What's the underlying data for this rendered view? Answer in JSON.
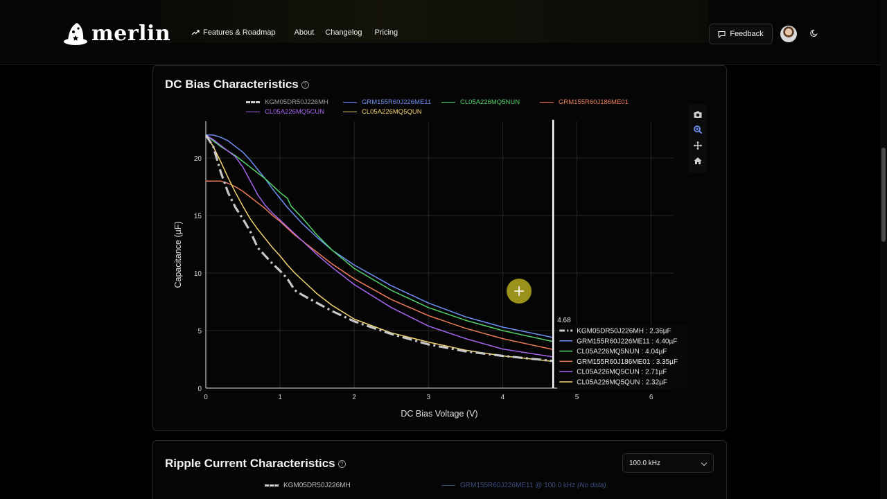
{
  "nav": {
    "brand": "merlin",
    "links": [
      "Features & Roadmap",
      "About",
      "Changelog",
      "Pricing"
    ],
    "feedback_label": "Feedback"
  },
  "dc_card": {
    "title": "DC Bias Characteristics",
    "help": "?"
  },
  "chart_data": {
    "type": "line",
    "xlabel": "DC Bias Voltage (V)",
    "ylabel": "Capacitance (µF)",
    "xlim": [
      0,
      6.3
    ],
    "ylim": [
      0,
      23.2
    ],
    "xticks": [
      0,
      1,
      2,
      3,
      4,
      5,
      6
    ],
    "yticks": [
      0,
      5,
      10,
      15,
      20
    ],
    "grid": true,
    "legend_position": "top",
    "series": [
      {
        "name": "KGM05DR50J226MH",
        "color": "#c8c8c8",
        "dash": "dashdot",
        "x": [
          0,
          0.1,
          0.2,
          0.3,
          0.4,
          0.5,
          0.6,
          0.7,
          0.8,
          0.9,
          1.0,
          1.1,
          1.2,
          1.3,
          1.5,
          1.7,
          2.0,
          2.5,
          3.0,
          3.5,
          4.0,
          4.68
        ],
        "y": [
          22.0,
          21.0,
          18.8,
          17.0,
          15.7,
          14.7,
          13.6,
          12.2,
          11.5,
          10.8,
          10.2,
          9.5,
          8.5,
          8.1,
          7.4,
          6.7,
          5.8,
          4.7,
          3.8,
          3.2,
          2.8,
          2.36
        ]
      },
      {
        "name": "GRM155R60J226ME11",
        "color": "#6f8ff5",
        "dash": "solid",
        "x": [
          0,
          0.1,
          0.2,
          0.3,
          0.4,
          0.5,
          0.6,
          0.7,
          0.8,
          0.9,
          1.0,
          1.1,
          1.2,
          1.3,
          1.5,
          1.7,
          2.0,
          2.5,
          3.0,
          3.5,
          4.0,
          4.68
        ],
        "y": [
          22.0,
          22.0,
          21.8,
          21.5,
          21.0,
          20.5,
          19.8,
          19.0,
          18.2,
          17.3,
          16.5,
          15.7,
          15.0,
          14.3,
          13.1,
          12.0,
          10.7,
          8.9,
          7.4,
          6.2,
          5.3,
          4.4
        ]
      },
      {
        "name": "CL05A226MQ5NUN",
        "color": "#54d46a",
        "dash": "solid",
        "x": [
          0,
          0.1,
          0.2,
          0.3,
          0.4,
          0.5,
          0.6,
          0.7,
          0.8,
          0.9,
          1.0,
          1.1,
          1.12,
          1.15,
          1.3,
          1.5,
          1.7,
          2.0,
          2.5,
          3.0,
          3.5,
          4.0,
          4.68
        ],
        "y": [
          22.0,
          21.5,
          21.0,
          20.6,
          20.2,
          19.7,
          19.2,
          18.7,
          18.2,
          17.6,
          17.0,
          16.5,
          16.2,
          15.8,
          14.8,
          13.3,
          12.0,
          10.4,
          8.5,
          7.0,
          5.9,
          5.0,
          4.04
        ]
      },
      {
        "name": "GRM155R60J186ME01",
        "color": "#ee7c58",
        "dash": "solid",
        "x": [
          0,
          0.1,
          0.2,
          0.3,
          0.4,
          0.5,
          0.6,
          0.7,
          0.8,
          0.9,
          1.0,
          1.1,
          1.2,
          1.3,
          1.5,
          1.7,
          2.0,
          2.5,
          3.0,
          3.5,
          4.0,
          4.68
        ],
        "y": [
          18.0,
          18.0,
          18.0,
          17.8,
          17.5,
          17.1,
          16.6,
          16.1,
          15.6,
          15.0,
          14.5,
          13.9,
          13.3,
          12.8,
          11.8,
          10.8,
          9.5,
          7.7,
          6.3,
          5.2,
          4.3,
          3.35
        ]
      },
      {
        "name": "CL05A226MQ5CUN",
        "color": "#a766ef",
        "dash": "solid",
        "x": [
          0,
          0.1,
          0.2,
          0.3,
          0.4,
          0.5,
          0.6,
          0.7,
          0.8,
          0.9,
          1.0,
          1.1,
          1.2,
          1.3,
          1.5,
          1.7,
          2.0,
          2.5,
          3.0,
          3.5,
          4.0,
          4.68
        ],
        "y": [
          22.0,
          21.6,
          21.1,
          20.6,
          20.1,
          19.2,
          18.0,
          16.8,
          15.9,
          15.2,
          14.6,
          14.0,
          13.4,
          12.8,
          11.6,
          10.5,
          9.0,
          7.0,
          5.4,
          4.3,
          3.4,
          2.71
        ]
      },
      {
        "name": "CL05A226MQ5QUN",
        "color": "#f3d66f",
        "dash": "solid",
        "x": [
          0,
          0.1,
          0.2,
          0.3,
          0.4,
          0.5,
          0.6,
          0.7,
          0.8,
          0.9,
          1.0,
          1.1,
          1.2,
          1.3,
          1.5,
          1.7,
          2.0,
          2.5,
          3.0,
          3.5,
          4.0,
          4.68
        ],
        "y": [
          22.0,
          21.0,
          19.7,
          18.3,
          17.0,
          15.8,
          14.7,
          13.8,
          13.0,
          12.2,
          11.5,
          10.7,
          10.0,
          9.4,
          8.2,
          7.2,
          6.0,
          4.8,
          4.0,
          3.3,
          2.8,
          2.32
        ]
      }
    ],
    "hover": {
      "x": 4.68,
      "label": "4.68",
      "rows": [
        {
          "name": "KGM05DR50J226MH",
          "value": "2.36µF"
        },
        {
          "name": "GRM155R60J226ME11",
          "value": "4.40µF"
        },
        {
          "name": "CL05A226MQ5NUN",
          "value": "4.04µF"
        },
        {
          "name": "GRM155R60J186ME01",
          "value": "3.35µF"
        },
        {
          "name": "CL05A226MQ5CUN",
          "value": "2.71µF"
        },
        {
          "name": "CL05A226MQ5QUN",
          "value": "2.32µF"
        }
      ]
    }
  },
  "ripple_card": {
    "title": "Ripple Current Characteristics",
    "help": "?",
    "frequency_select": "100.0 kHz",
    "legend": [
      {
        "name": "KGM05DR50J226MH",
        "color": "#c8c8c8"
      },
      {
        "name": "GRM155R60J226ME11 @ 100.0 kHz",
        "note": "(No data)",
        "color": "#6f8ff5"
      }
    ]
  },
  "colors": {
    "background": "#000000",
    "card": "#050505",
    "grid": "#262626",
    "cursor_line": "#ffffff",
    "cursor_marker": "#a29a1c"
  }
}
